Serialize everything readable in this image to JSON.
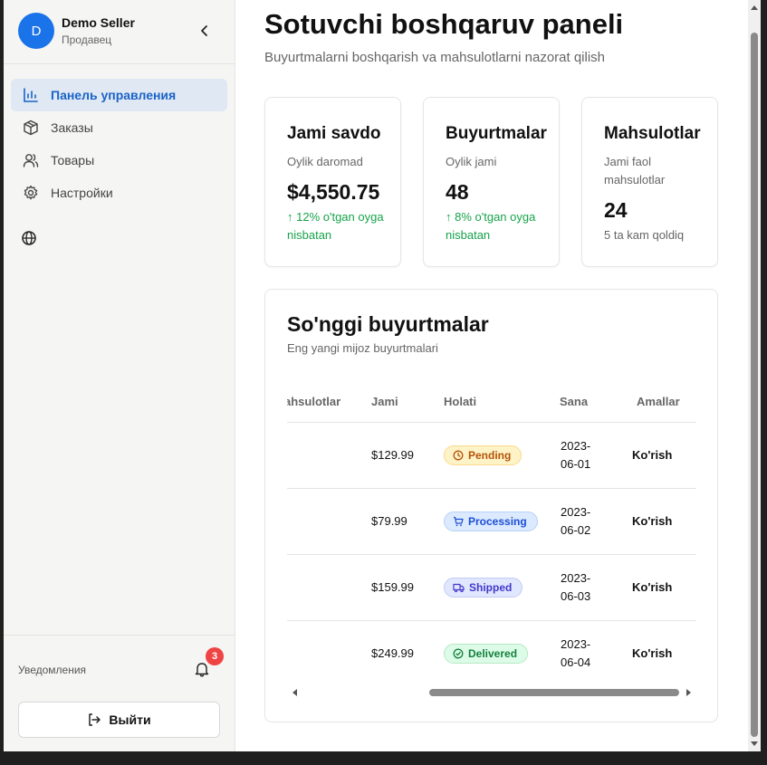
{
  "sidebar": {
    "user": {
      "initial": "D",
      "name": "Demo Seller",
      "role": "Продавец"
    },
    "nav": [
      {
        "label": "Панель управления",
        "icon": "bar-chart-icon",
        "active": true
      },
      {
        "label": "Заказы",
        "icon": "package-icon",
        "active": false
      },
      {
        "label": "Товары",
        "icon": "users-icon",
        "active": false
      },
      {
        "label": "Настройки",
        "icon": "gear-icon",
        "active": false
      }
    ],
    "notifications_label": "Уведомления",
    "notifications_count": "3",
    "logout_label": "Выйти"
  },
  "main": {
    "title": "Sotuvchi boshqaruv paneli",
    "subtitle": "Buyurtmalarni boshqarish va mahsulotlarni nazorat qilish",
    "stats": [
      {
        "title": "Jami savdo",
        "desc": "Oylik daromad",
        "value": "$4,550.75",
        "trend": "↑ 12% o'tgan oyga nisbatan"
      },
      {
        "title": "Buyurtmalar",
        "desc": "Oylik jami",
        "value": "48",
        "trend": "↑ 8% o'tgan oyga nisbatan"
      },
      {
        "title": "Mahsulotlar",
        "desc": "Jami faol mahsulotlar",
        "value": "24",
        "note": "5 ta kam qoldiq"
      }
    ],
    "orders": {
      "title": "So'nggi buyurtmalar",
      "subtitle": "Eng yangi mijoz buyurtmalari",
      "columns": [
        "ahsulotlar",
        "Jami",
        "Holati",
        "Sana",
        "Amallar"
      ],
      "rows": [
        {
          "total": "$129.99",
          "status": "Pending",
          "date": "2023-06-01",
          "action": "Ko'rish"
        },
        {
          "total": "$79.99",
          "status": "Processing",
          "date": "2023-06-02",
          "action": "Ko'rish"
        },
        {
          "total": "$159.99",
          "status": "Shipped",
          "date": "2023-06-03",
          "action": "Ko'rish"
        },
        {
          "total": "$249.99",
          "status": "Delivered",
          "date": "2023-06-04",
          "action": "Ko'rish"
        }
      ]
    }
  },
  "colors": {
    "accent": "#1a73e8",
    "pending_bg": "#fef3c7",
    "pending_fg": "#b45309",
    "processing_bg": "#dbeafe",
    "processing_fg": "#1d4ed8",
    "shipped_bg": "#e0e7ff",
    "shipped_fg": "#4338ca",
    "delivered_bg": "#dcfce7",
    "delivered_fg": "#15803d",
    "trend_up": "#16a34a",
    "badge": "#ef4444"
  }
}
